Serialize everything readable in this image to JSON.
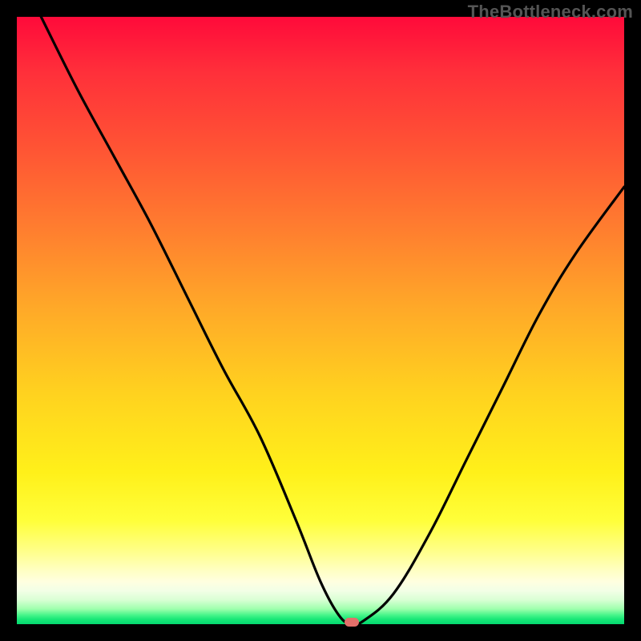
{
  "watermark": "TheBottleneck.com",
  "chart_data": {
    "type": "line",
    "title": "",
    "xlabel": "",
    "ylabel": "",
    "xlim": [
      0,
      100
    ],
    "ylim": [
      0,
      100
    ],
    "grid": false,
    "legend": false,
    "series": [
      {
        "name": "bottleneck-curve",
        "x": [
          4,
          10,
          16,
          22,
          28,
          34,
          40,
          46,
          50,
          53,
          55,
          57,
          62,
          68,
          74,
          80,
          86,
          92,
          100
        ],
        "y": [
          100,
          88,
          77,
          66,
          54,
          42,
          31,
          17,
          7,
          1.5,
          0,
          0.5,
          5,
          15,
          27,
          39,
          51,
          61,
          72
        ],
        "color": "#000000"
      }
    ],
    "marker": {
      "x": 55.2,
      "y": 0,
      "color": "#e36f6a"
    },
    "background_gradient_stops": [
      {
        "pos": 0,
        "color": "#ff0a3a"
      },
      {
        "pos": 50,
        "color": "#ffc020"
      },
      {
        "pos": 85,
        "color": "#ffff60"
      },
      {
        "pos": 100,
        "color": "#04d96f"
      }
    ]
  }
}
